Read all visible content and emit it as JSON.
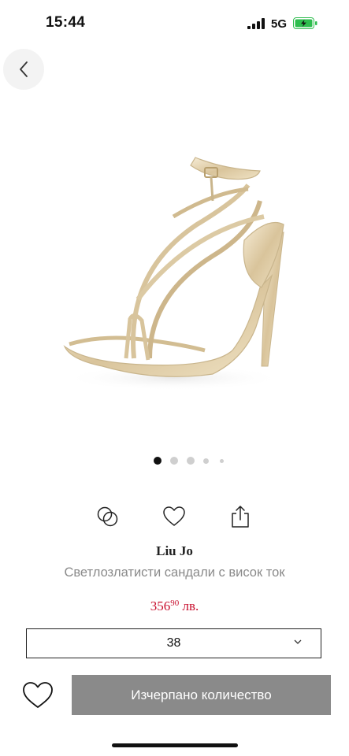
{
  "status_bar": {
    "time": "15:44",
    "network": "5G",
    "battery_charging": true
  },
  "product": {
    "brand": "Liu Jo",
    "name": "Светлозлатисти сандали с висок ток",
    "price_main": "356",
    "price_cents": "90",
    "currency": "лв."
  },
  "gallery": {
    "total_images": 5,
    "active_index": 0
  },
  "size_selector": {
    "selected": "38"
  },
  "cart_button": {
    "label": "Изчерпано количество"
  },
  "icons": {
    "back": "chevron-left-icon",
    "compare": "compare-icon",
    "favorite": "heart-icon",
    "share": "share-icon",
    "dropdown": "chevron-down-icon"
  },
  "colors": {
    "price": "#c8102e",
    "button_disabled": "#8a8a8a",
    "active_dot": "#111111"
  }
}
